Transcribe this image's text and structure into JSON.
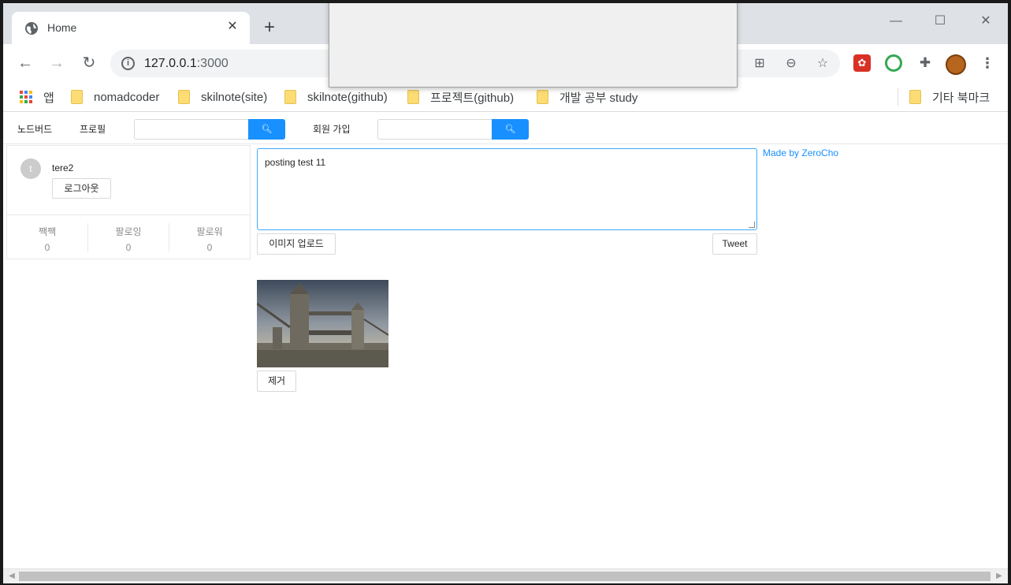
{
  "browser": {
    "tab_title": "Home",
    "url_host": "127.0.0.1",
    "url_port": ":3000",
    "bookmarks": [
      {
        "label": "앱"
      },
      {
        "label": "nomadcoder"
      },
      {
        "label": "skilnote(site)"
      },
      {
        "label": "skilnote(github)"
      },
      {
        "label": "프로젝트(github)"
      },
      {
        "label": "개발 공부 study"
      }
    ],
    "other_bookmarks": "기타 북마크"
  },
  "nav": {
    "nodebird": "노드버드",
    "profile": "프로필",
    "signup": "회원 가입"
  },
  "user": {
    "avatar_letter": "t",
    "nickname": "tere2",
    "logout_label": "로그아웃",
    "stats": [
      {
        "label": "짹짹",
        "value": "0"
      },
      {
        "label": "팔로잉",
        "value": "0"
      },
      {
        "label": "팔로워",
        "value": "0"
      }
    ]
  },
  "post_form": {
    "text": "posting test 11",
    "upload_label": "이미지 업로드",
    "tweet_label": "Tweet",
    "remove_label": "제거"
  },
  "made_by": "Made by ZeroCho",
  "colors": {
    "primary": "#1890ff",
    "tab_strip": "#dee1e6",
    "folder": "#fcdc74"
  }
}
